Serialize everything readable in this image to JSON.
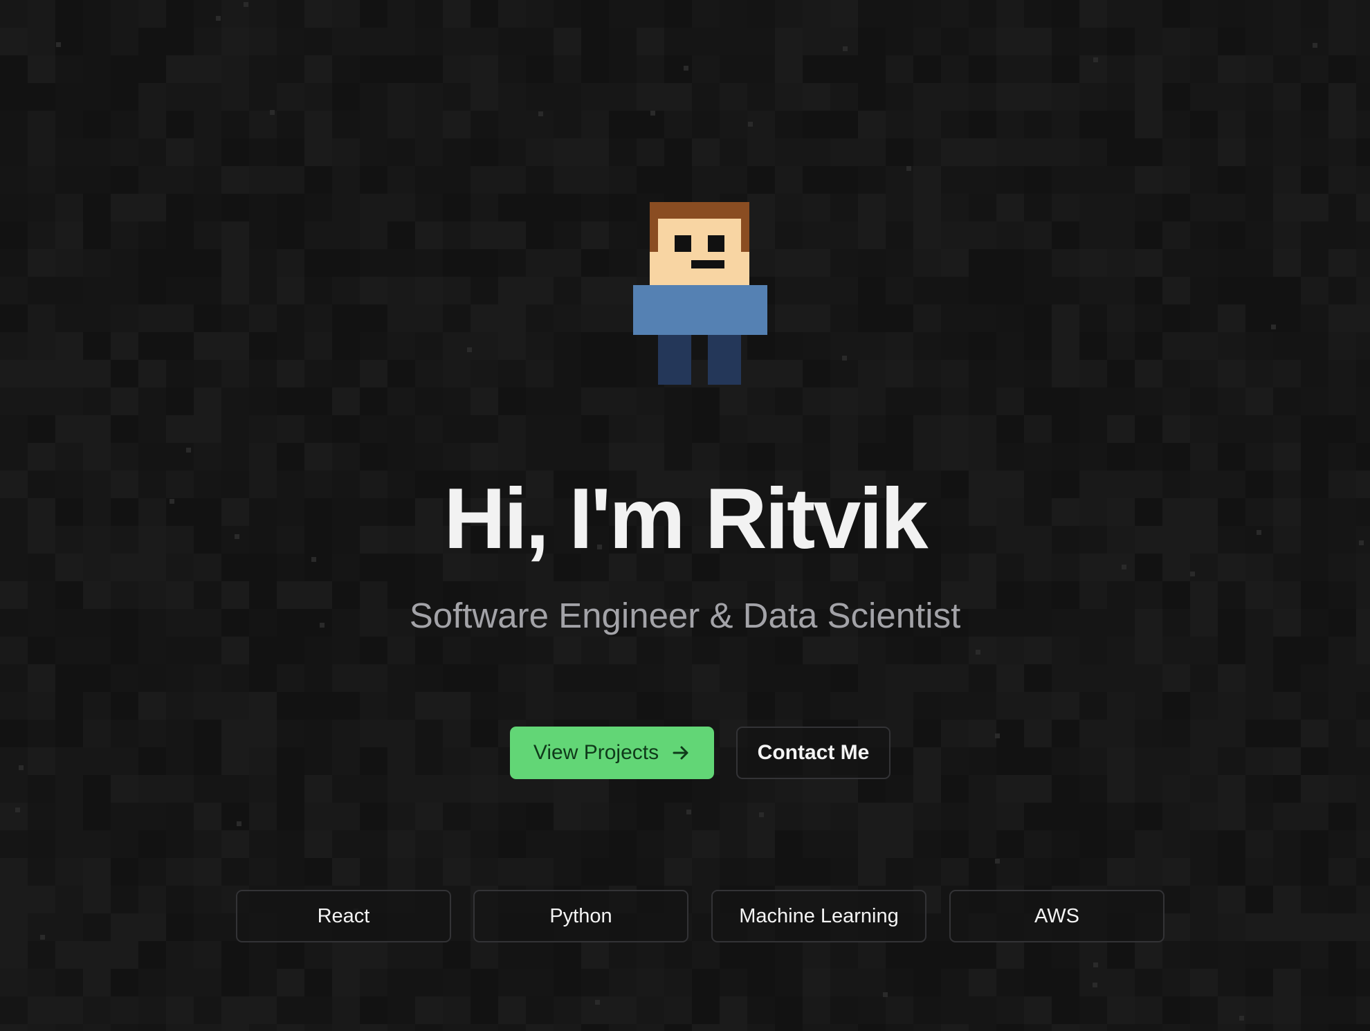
{
  "hero": {
    "headline": "Hi, I'm Ritvik",
    "subtitle": "Software Engineer & Data Scientist"
  },
  "actions": {
    "primary_label": "View Projects",
    "secondary_label": "Contact Me"
  },
  "skills": [
    "React",
    "Python",
    "Machine Learning",
    "AWS"
  ],
  "colors": {
    "background": "#161616",
    "accent": "#62d676",
    "hair": "#8a4d22",
    "skin": "#f8d5a3",
    "shirt": "#5581b3",
    "pants": "#243759"
  }
}
